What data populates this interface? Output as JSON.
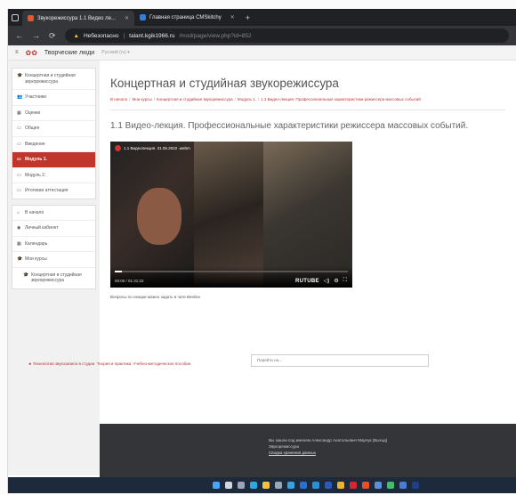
{
  "browser": {
    "tabs": [
      {
        "title": "Звукорежиссура 1.1 Видео ле...",
        "active": true,
        "favicon_color": "#e2572b"
      },
      {
        "title": "Главная страница CMSkitchy",
        "active": false,
        "favicon_color": "#2f7fe0"
      }
    ],
    "security_label": "Небезопасно",
    "url_domain": "talant.kgik1966.ru",
    "url_path": "/mod/page/view.php?id=852"
  },
  "site": {
    "brand": "Творческие люди",
    "menu_label": "Русский (ru) ▾"
  },
  "sidebar": {
    "course_items": [
      {
        "label": "Концертная и студийная звукорежиссура",
        "icon": "graduation-cap-icon",
        "glyph": "🎓"
      },
      {
        "label": "Участники",
        "icon": "users-icon",
        "glyph": "👥"
      },
      {
        "label": "Оценки",
        "icon": "grades-icon",
        "glyph": "▦"
      },
      {
        "label": "Общее",
        "icon": "folder-icon",
        "glyph": "▭"
      },
      {
        "label": "Введение",
        "icon": "folder-icon",
        "glyph": "▭"
      },
      {
        "label": "Модуль 1.",
        "icon": "folder-icon",
        "glyph": "▭",
        "active": true
      },
      {
        "label": "Модуль 2.",
        "icon": "folder-icon",
        "glyph": "▭"
      },
      {
        "label": "Итоговая аттестация",
        "icon": "folder-icon",
        "glyph": "▭"
      }
    ],
    "nav_items": [
      {
        "label": "В начало",
        "icon": "home-icon",
        "glyph": "⌂"
      },
      {
        "label": "Личный кабинет",
        "icon": "dashboard-icon",
        "glyph": "◉"
      },
      {
        "label": "Календарь",
        "icon": "calendar-icon",
        "glyph": "▦"
      },
      {
        "label": "Мои курсы",
        "icon": "graduation-cap-icon",
        "glyph": "🎓"
      },
      {
        "label": "Концертная и студийная звукорежиссура",
        "icon": "graduation-cap-icon",
        "glyph": "🎓",
        "indent": true
      }
    ]
  },
  "main": {
    "course_title": "Концертная и студийная звукорежиссура",
    "breadcrumb": [
      "В начало",
      "Мои курсы",
      "Концертная и студийная звукорежиссура",
      "Модуль 1.",
      "1.1 Видео-лекция. Профессиональные характеристики режиссера массовых событий"
    ],
    "lecture_title": "1.1 Видео-лекция. Профессиональные характеристики режиссера массовых событий.",
    "video": {
      "title": "1.1 Видеолекция. 31.05.2022 .webm",
      "time": "00:00 / 01:31:22",
      "provider": "RUTUBE",
      "progress": 0.03
    },
    "note": "Вопросы по лекции можно задать в чате Beeline",
    "prev_link": "◄ Технологии звукозаписи в студии. Теория и практика. Учебно-методическое пособие.",
    "jump_placeholder": "Перейти на..."
  },
  "footer": {
    "login_text": "Вы зашли под именем Александр Анатольевич Марчук (Выход)",
    "course_link": "Звукорежиссура",
    "data_link": "Сводка хранения данных"
  }
}
